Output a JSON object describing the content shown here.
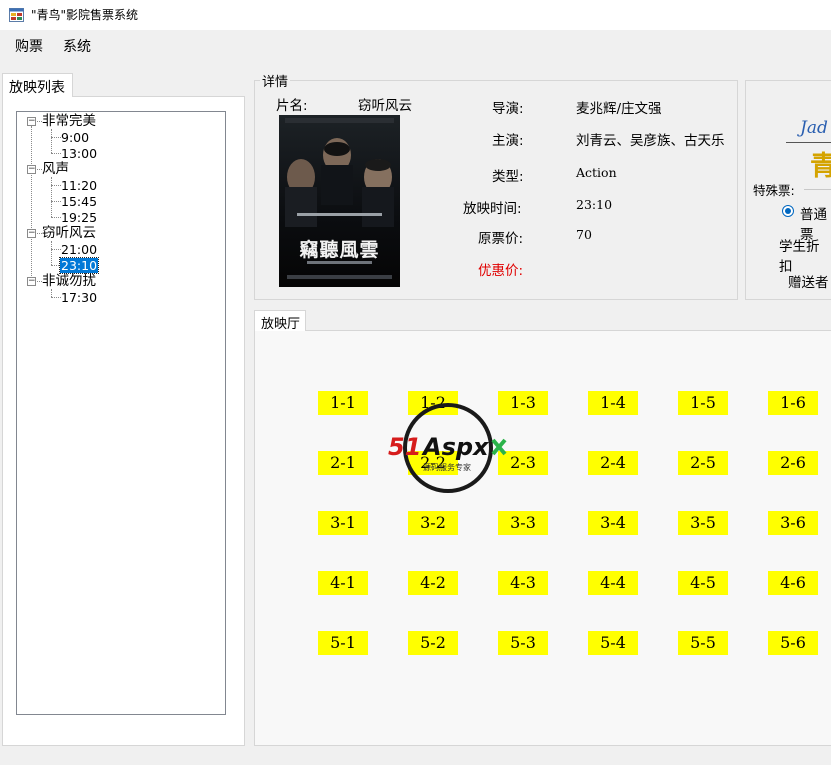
{
  "window": {
    "title": "\"青鸟\"影院售票系统"
  },
  "menu": [
    "购票",
    "系统"
  ],
  "left_tab": "放映列表",
  "tree": [
    {
      "title": "非常完美",
      "times": [
        "9:00",
        "13:00"
      ]
    },
    {
      "title": "风声",
      "times": [
        "11:20",
        "15:45",
        "19:25"
      ]
    },
    {
      "title": "窃听风云",
      "times": [
        "21:00",
        "23:10"
      ]
    },
    {
      "title": "非诚勿扰",
      "times": [
        "17:30"
      ]
    }
  ],
  "selected_time": "23:10",
  "detail": {
    "legend": "详情",
    "name_label": "片名:",
    "name_value": "窃听风云",
    "director_label": "导演:",
    "director_value": "麦兆辉/庄文强",
    "actors_label": "主演:",
    "actors_value": "刘青云、吴彦族、古天乐",
    "type_label": "类型:",
    "type_value": "Action",
    "time_label": "放映时间:",
    "time_value": "23:10",
    "price_label": "原票价:",
    "price_value": "70",
    "discount_label": "优惠价:",
    "discount_color": "#e00000"
  },
  "poster": {
    "title_text": "竊聽風雲"
  },
  "special": {
    "logo_text": "Jad",
    "logo_char": "青",
    "label": "特殊票:",
    "radio_normal": "普通票",
    "student_discount": "学生折扣",
    "gift_label": "赠送者"
  },
  "hall": {
    "tab": "放映厅",
    "seats": [
      [
        "1-1",
        "1-2",
        "1-3",
        "1-4",
        "1-5",
        "1-6"
      ],
      [
        "2-1",
        "2-2",
        "2-3",
        "2-4",
        "2-5",
        "2-6"
      ],
      [
        "3-1",
        "3-2",
        "3-3",
        "3-4",
        "3-5",
        "3-6"
      ],
      [
        "4-1",
        "4-2",
        "4-3",
        "4-4",
        "4-5",
        "4-6"
      ],
      [
        "5-1",
        "5-2",
        "5-3",
        "5-4",
        "5-5",
        "5-6"
      ]
    ],
    "seat_color": "#ffff00"
  },
  "watermark": {
    "brand": "51Aspx",
    "tagline": "源码服务专家"
  }
}
